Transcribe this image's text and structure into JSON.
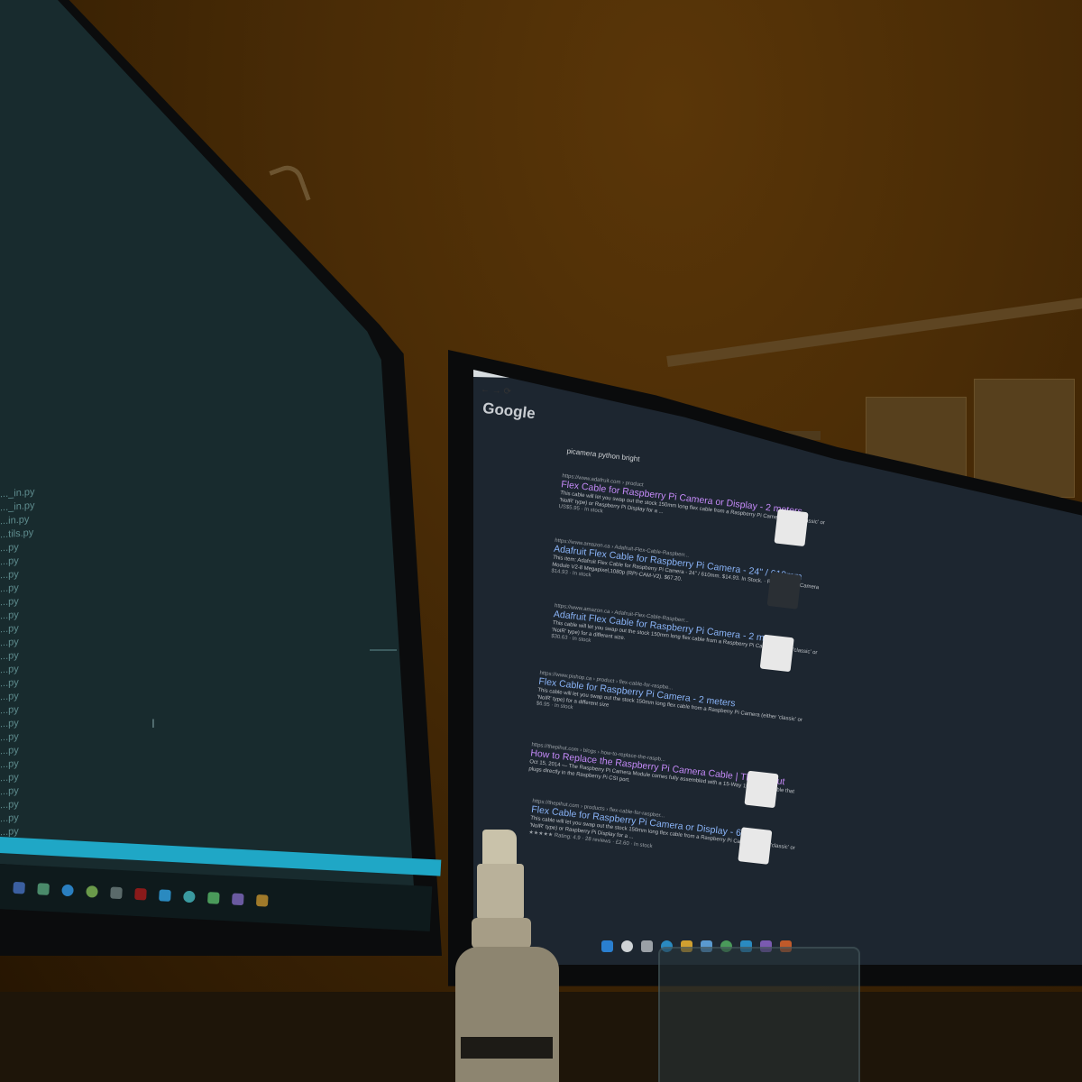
{
  "left_monitor": {
    "file_items": [
      "..._in.py",
      "..._in.py",
      "...in.py",
      "...tils.py",
      "...py",
      "...py",
      "...py",
      "...py",
      "...py",
      "...py",
      "...py",
      "...py",
      "...py",
      "...py",
      "...py",
      "...py",
      "...py",
      "...py",
      "...py",
      "...py",
      "...py",
      "...py",
      "...py",
      "...py",
      "...py",
      "...py"
    ]
  },
  "right_monitor": {
    "browser": {
      "logo": "Google",
      "query": "picamera python bright",
      "results": [
        {
          "url": "https://www.adafruit.com › product",
          "title": "Flex Cable for Raspberry Pi Camera or Display - 2 meters",
          "snippet": "This cable will let you swap out the stock 150mm long flex cable from a Raspberry Pi Camera (either 'classic' or 'NoIR' type) or Raspberry Pi Display for a ...",
          "price": "US$5.95 · In stock"
        },
        {
          "url": "https://www.amazon.ca › Adafruit-Flex-Cable-Raspberr...",
          "title": "Adafruit Flex Cable for Raspberry Pi Camera - 24\" / 610mm",
          "snippet": "This item: Adafruit Flex Cable for Raspberry Pi Camera - 24\" / 610mm. $14.93. In Stock. · Raspberry Pi Camera Module V2-8 Megapixel,1080p (RPI-CAM-V2). $67.20.",
          "price": "$14.93 · In stock"
        },
        {
          "url": "https://www.amazon.ca › Adafruit-Flex-Cable-Raspberr...",
          "title": "Adafruit Flex Cable for Raspberry Pi Camera - 2 meters",
          "snippet": "This cable will let you swap out the stock 150mm long flex cable from a Raspberry Pi Camera (either 'classic' or 'NoIR' type) for a different size.",
          "price": "$30.63 · In stock"
        },
        {
          "url": "https://www.pishop.ca › product › flex-cable-for-raspbe...",
          "title": "Flex Cable for Raspberry Pi Camera - 2 meters",
          "snippet": "This cable will let you swap out the stock 150mm long flex cable from a Raspberry Pi Camera (either 'classic' or 'NoIR' type) for a different size",
          "price": "$6.95 · In stock"
        },
        {
          "url": "https://thepihut.com › blogs › how-to-replace-the-raspb...",
          "title": "How to Replace the Raspberry Pi Camera Cable | The Pi Hut",
          "snippet": "Oct 15, 2014 — The Raspberry Pi Camera Module comes fully assembled with a 15-Way 150mm flat cable that plugs directly in the Raspberry Pi CSI port.",
          "price": ""
        },
        {
          "url": "https://thepihut.com › products › flex-cable-for-raspber...",
          "title": "Flex Cable for Raspberry Pi Camera or Display - 610mm",
          "snippet": "This cable will let you swap out the stock 150mm long flex cable from a Raspberry Pi Camera (either 'classic' or 'NoIR' type) or Raspberry Pi Display for a ...",
          "price": "★★★★★ Rating: 4.9 · 28 reviews · £2.60 · In stock"
        }
      ]
    }
  },
  "colors": {
    "left_screen": "#182b2e",
    "left_accent_bar": "#1fa7c6",
    "right_screen": "#1d2630",
    "link_blue": "#8ab4f8",
    "link_visited": "#c58af9",
    "wall": "#4a2c06"
  }
}
